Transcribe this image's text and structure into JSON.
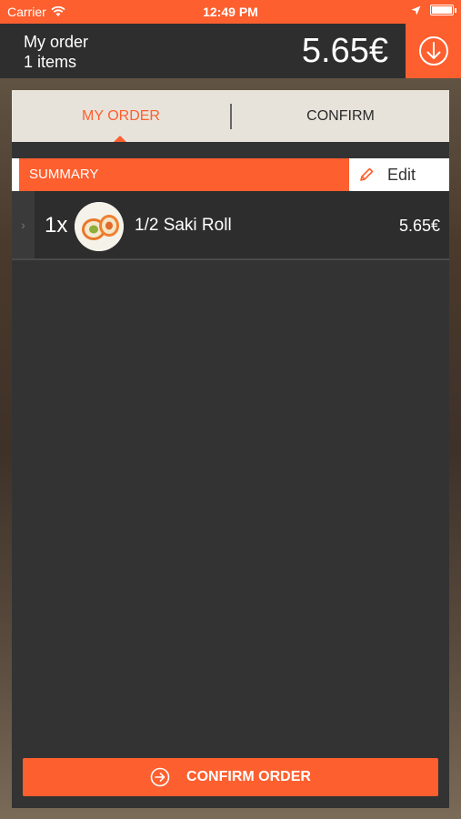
{
  "status_bar": {
    "carrier": "Carrier",
    "time": "12:49 PM"
  },
  "header": {
    "title": "My order",
    "items_count": "1 items",
    "total": "5.65€",
    "down_icon": "arrow-down-circle-icon"
  },
  "tabs": [
    {
      "label": "MY ORDER",
      "active": true
    },
    {
      "label": "CONFIRM",
      "active": false
    }
  ],
  "summary": {
    "label": "SUMMARY",
    "edit_label": "Edit",
    "edit_icon": "pencil-icon"
  },
  "order_items": [
    {
      "quantity": "1x",
      "name": "1/2 Saki Roll",
      "price": "5.65€",
      "thumb_icon": "sushi-roll-image"
    }
  ],
  "confirm_button": {
    "label": "CONFIRM ORDER",
    "icon": "arrow-right-circle-icon"
  },
  "colors": {
    "accent": "#fd5f2f",
    "panel": "#333333",
    "header": "#2e2e2e",
    "tab_bar": "#e8e3da"
  }
}
